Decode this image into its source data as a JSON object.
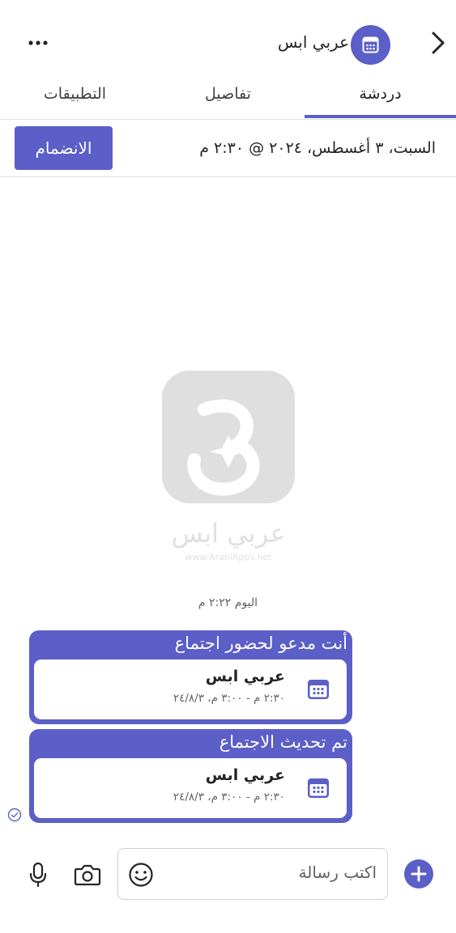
{
  "header": {
    "title": "عربي ابس",
    "back_icon": "chevron-right-icon",
    "avatar_icon": "calendar-icon",
    "more_icon": "more-horizontal-icon"
  },
  "tabs": [
    {
      "label": "دردشة",
      "active": true
    },
    {
      "label": "تفاصيل",
      "active": false
    },
    {
      "label": "التطبيقات",
      "active": false
    }
  ],
  "banner": {
    "datetime": "السبت، ٣ أغسطس، ٢٠٢٤ @ ٢:٣٠ م",
    "join_label": "الانضمام"
  },
  "watermark": {
    "brand": "عربي ابس",
    "url": "www.ArabiApps.net"
  },
  "conversation": {
    "time_divider": "اليوم ٢:٢٢ م",
    "messages": [
      {
        "title": "أنت مدعو لحضور اجتماع",
        "card_title": "عربي ابس",
        "card_subtitle": "٢:٣٠ م - ٣:٠٠ م، ٢٤/٨/٣"
      },
      {
        "title": "تم تحديث الاجتماع",
        "card_title": "عربي ابس",
        "card_subtitle": "٢:٣٠ م - ٣:٠٠ م، ٢٤/٨/٣"
      }
    ]
  },
  "composer": {
    "placeholder": "اكتب رسالة"
  },
  "colors": {
    "accent": "#5b5fc7",
    "text": "#242424",
    "secondary_text": "#616161"
  }
}
